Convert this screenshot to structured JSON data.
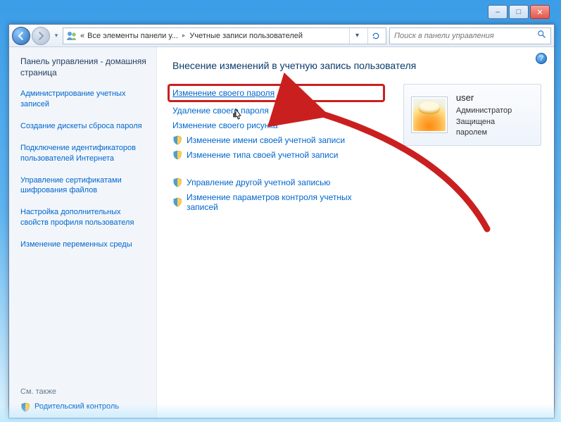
{
  "titlebar": {
    "minimize": "–",
    "maximize": "□",
    "close": "✕"
  },
  "navbar": {
    "breadcrumb": {
      "root_icon": "control-panel",
      "item1": "Все элементы панели у...",
      "item2": "Учетные записи пользователей"
    },
    "search_placeholder": "Поиск в панели управления"
  },
  "sidebar": {
    "heading": "Панель управления - домашняя страница",
    "links": [
      "Администрирование учетных записей",
      "Создание дискеты сброса пароля",
      "Подключение идентификаторов пользователей Интернета",
      "Управление сертификатами шифрования файлов",
      "Настройка дополнительных свойств профиля пользователя",
      "Изменение переменных среды"
    ],
    "seealso_heading": "См. также",
    "seealso_label": "Родительский контроль"
  },
  "main": {
    "title": "Внесение изменений в учетную запись пользователя",
    "help": "?",
    "links_plain": [
      "Изменение своего пароля",
      "Удаление своего пароля",
      "Изменение своего рисунка"
    ],
    "links_shield": [
      "Изменение имени своей учетной записи",
      "Изменение типа своей учетной записи"
    ],
    "links_shield2": [
      "Управление другой учетной записью",
      "Изменение параметров контроля учетных записей"
    ]
  },
  "user_card": {
    "name": "user",
    "role": "Администратор",
    "status": "Защищена паролем"
  }
}
